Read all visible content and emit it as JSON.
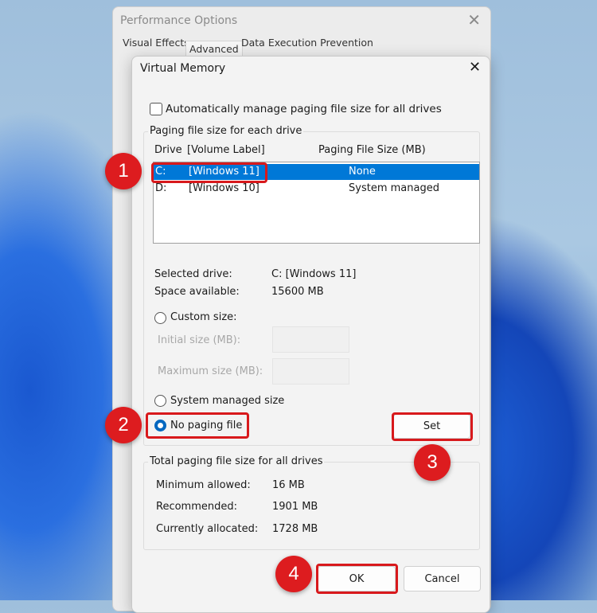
{
  "perf": {
    "title": "Performance Options",
    "tabs": [
      "Visual Effects",
      "Advanced",
      "Data Execution Prevention"
    ]
  },
  "vm": {
    "title": "Virtual Memory",
    "auto_manage": "Automatically manage paging file size for all drives",
    "group1": "Paging file size for each drive",
    "headers": {
      "drive": "Drive",
      "label": "[Volume Label]",
      "size": "Paging File Size (MB)"
    },
    "drives": [
      {
        "drive": "C:",
        "label": "[Windows 11]",
        "size": "None"
      },
      {
        "drive": "D:",
        "label": "[Windows 10]",
        "size": "System managed"
      }
    ],
    "selected_drive_label": "Selected drive:",
    "selected_drive_value": "C:  [Windows 11]",
    "space_label": "Space available:",
    "space_value": "15600 MB",
    "custom": "Custom size:",
    "initial": "Initial size (MB):",
    "maximum": "Maximum size (MB):",
    "system": "System managed size",
    "nopaging": "No paging file",
    "set": "Set",
    "group2": "Total paging file size for all drives",
    "min_label": "Minimum allowed:",
    "min_value": "16 MB",
    "rec_label": "Recommended:",
    "rec_value": "1901 MB",
    "cur_label": "Currently allocated:",
    "cur_value": "1728 MB",
    "ok": "OK",
    "cancel": "Cancel"
  },
  "callouts": [
    "1",
    "2",
    "3",
    "4"
  ],
  "colors": {
    "accent": "#0078d7",
    "callout": "#dd1c1f"
  }
}
